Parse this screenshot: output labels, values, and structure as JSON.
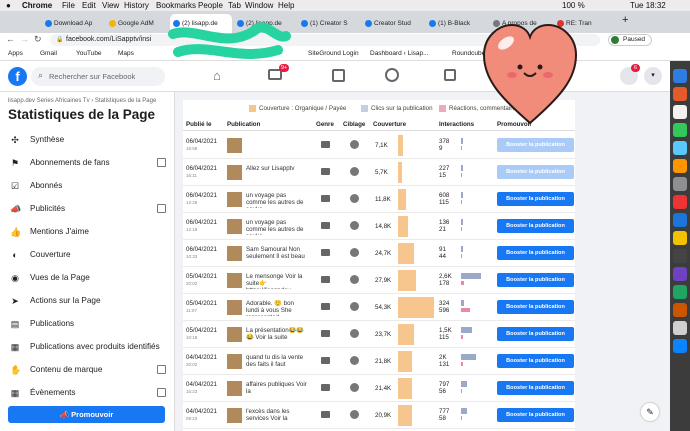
{
  "menubar": {
    "app": "Chrome",
    "items": [
      "File",
      "Edit",
      "View",
      "History",
      "Bookmarks",
      "People",
      "Tab",
      "Window",
      "Help"
    ],
    "battery": "100 %",
    "clock": "Tue 18:32"
  },
  "tabs": [
    {
      "label": "Download Ap"
    },
    {
      "label": "Google AdM"
    },
    {
      "label": "(2) lisapp.de"
    },
    {
      "label": "(2) lisapp.de"
    },
    {
      "label": "(1) Creator S"
    },
    {
      "label": "Creator Stud"
    },
    {
      "label": "(1) B-Black"
    },
    {
      "label": "A propos de"
    },
    {
      "label": "RE: Tran"
    }
  ],
  "url": "facebook.com/LiSapptv/insi",
  "profile_status": "Paused",
  "bookmarks": [
    "Apps",
    "Gmail",
    "YouTube",
    "Maps",
    "Google AdSense –",
    "SiteGround Login",
    "Dashboard ‹ Lisap...",
    "Roundcube"
  ],
  "fb": {
    "search_placeholder": "Rechercher sur Facebook",
    "notif_badge": "9+",
    "notif_count": "6"
  },
  "sidebar": {
    "breadcrumb": "lisapp.dev Series Africaines Tv › Statistiques de la Page",
    "title": "Statistiques de la Page",
    "items": [
      {
        "label": "Synthèse",
        "icon": "synthese-icon",
        "ext": false
      },
      {
        "label": "Abonnements de fans",
        "icon": "fans-icon",
        "ext": true
      },
      {
        "label": "Abonnés",
        "icon": "abonnes-icon",
        "ext": false
      },
      {
        "label": "Publicités",
        "icon": "ads-icon",
        "ext": true
      },
      {
        "label": "Mentions J'aime",
        "icon": "like-icon",
        "ext": false
      },
      {
        "label": "Couverture",
        "icon": "reach-icon",
        "ext": false
      },
      {
        "label": "Vues de la Page",
        "icon": "eye-icon",
        "ext": false
      },
      {
        "label": "Actions sur la Page",
        "icon": "cursor-icon",
        "ext": false
      },
      {
        "label": "Publications",
        "icon": "posts-icon",
        "ext": false
      },
      {
        "label": "Publications avec produits identifiés",
        "icon": "tag-icon",
        "ext": false
      },
      {
        "label": "Contenu de marque",
        "icon": "brand-icon",
        "ext": true
      },
      {
        "label": "Évènements",
        "icon": "calendar-icon",
        "ext": true
      }
    ],
    "promote": "Promouvoir"
  },
  "legend": {
    "a": "Couverture : Organique / Payée",
    "b": "Clics sur la publication",
    "c": "Réactions, commentaires"
  },
  "columns": [
    "Publié le",
    "Publication",
    "Genre",
    "Ciblage",
    "Couverture",
    "Interactions",
    "Promouvoir"
  ],
  "rows": [
    {
      "date": "06/04/2021",
      "time": "16:58",
      "text": "",
      "reach": "7,1K",
      "reach_frac": 0.13,
      "i1": "378",
      "i2": "9",
      "b1": 0.04,
      "b2": 0.01,
      "type": "video",
      "boost": "Booster la publication",
      "disabled": true
    },
    {
      "date": "06/04/2021",
      "time": "16:11",
      "text": "Allez sur Lisapptv",
      "reach": "5,7K",
      "reach_frac": 0.1,
      "i1": "227",
      "i2": "15",
      "b1": 0.03,
      "b2": 0.02,
      "type": "video",
      "boost": "Booster la publication",
      "disabled": true
    },
    {
      "date": "06/04/2021",
      "time": "12:28",
      "text": "un voyage pas comme les autres de souke",
      "reach": "11,8K",
      "reach_frac": 0.22,
      "i1": "608",
      "i2": "115",
      "b1": 0.07,
      "b2": 0.04,
      "type": "video",
      "boost": "Booster la publication",
      "disabled": false
    },
    {
      "date": "06/04/2021",
      "time": "12:18",
      "text": "un voyage pas comme les autres de souke",
      "reach": "14,8K",
      "reach_frac": 0.27,
      "i1": "136",
      "i2": "21",
      "b1": 0.05,
      "b2": 0.02,
      "type": "video",
      "boost": "Booster la publication",
      "disabled": false
    },
    {
      "date": "06/04/2021",
      "time": "10:33",
      "text": "Sam Samoural Non seulement Il est beau",
      "reach": "24,7K",
      "reach_frac": 0.45,
      "i1": "91",
      "i2": "44",
      "b1": 0.03,
      "b2": 0.02,
      "type": "photo",
      "boost": "Booster la publication",
      "disabled": false
    },
    {
      "date": "05/04/2021",
      "time": "20:02",
      "text": "Le mensonge Voir la suite👉https://lisappdev.",
      "reach": "27,9K",
      "reach_frac": 0.51,
      "i1": "2,6K",
      "i2": "178",
      "b1": 0.6,
      "b2": 0.1,
      "type": "video",
      "boost": "Booster la publication",
      "disabled": false
    },
    {
      "date": "05/04/2021",
      "time": "11:07",
      "text": "Adorable. 🙂 bon lundi à vous She represented",
      "reach": "54,3K",
      "reach_frac": 1.0,
      "i1": "324",
      "i2": "596",
      "b1": 0.1,
      "b2": 0.25,
      "type": "photo",
      "boost": "Booster la publication",
      "disabled": false
    },
    {
      "date": "05/04/2021",
      "time": "10:18",
      "text": "La présentation😂😂😂 Voir la suite",
      "reach": "23,7K",
      "reach_frac": 0.44,
      "i1": "1,5K",
      "i2": "115",
      "b1": 0.33,
      "b2": 0.05,
      "type": "video",
      "boost": "Booster la publication",
      "disabled": false
    },
    {
      "date": "04/04/2021",
      "time": "20:02",
      "text": "quand tu dis la vente des faits il faut",
      "reach": "21,8K",
      "reach_frac": 0.4,
      "i1": "2K",
      "i2": "131",
      "b1": 0.45,
      "b2": 0.05,
      "type": "video",
      "boost": "Booster la publication",
      "disabled": false
    },
    {
      "date": "04/04/2021",
      "time": "15:23",
      "text": "affaires publiques Voir la",
      "reach": "21,4K",
      "reach_frac": 0.39,
      "i1": "797",
      "i2": "56",
      "b1": 0.18,
      "b2": 0.03,
      "type": "video",
      "boost": "Booster la publication",
      "disabled": false
    },
    {
      "date": "04/04/2021",
      "time": "09:23",
      "text": "l'excès dans les services Voir la",
      "reach": "20,9K",
      "reach_frac": 0.38,
      "i1": "777",
      "i2": "58",
      "b1": 0.17,
      "b2": 0.03,
      "type": "video",
      "boost": "Booster la publication",
      "disabled": false
    }
  ]
}
